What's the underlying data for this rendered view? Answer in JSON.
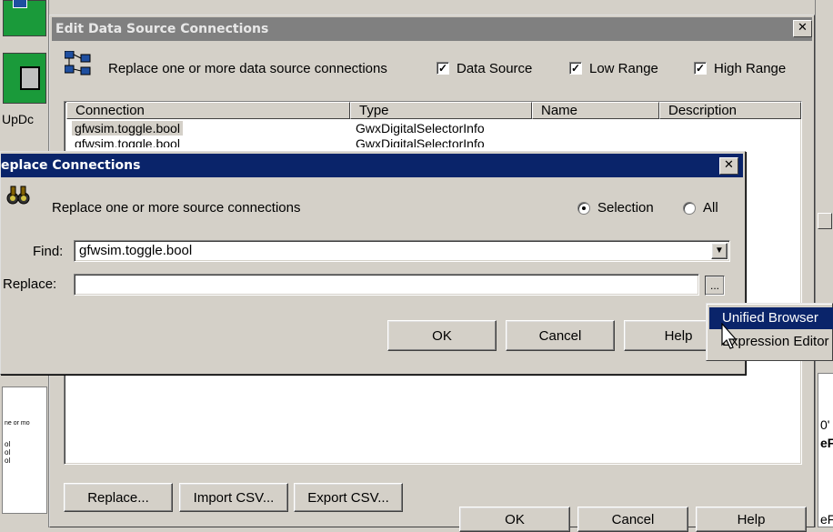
{
  "background": {
    "left_strip_text_1": "UpDc",
    "left_strip_text_2": "ne or mo",
    "left_strip_text_3": "ol",
    "left_strip_text_4": "ol",
    "left_strip_text_5": "ol",
    "right_strip_text_1": "0'",
    "right_strip_text_2": "eF",
    "right_strip_text_3": "eF"
  },
  "edit_dialog": {
    "title": "Edit Data Source Connections",
    "close_glyph": "✕",
    "description": "Replace one or more data source connections",
    "checkboxes": [
      {
        "label": "Data Source",
        "checked": true
      },
      {
        "label": "Low Range",
        "checked": true
      },
      {
        "label": "High Range",
        "checked": true
      }
    ],
    "check_glyph": "✓",
    "columns": [
      "Connection",
      "Type",
      "Name",
      "Description"
    ],
    "rows": [
      {
        "connection": "gfwsim.toggle.bool",
        "type": "GwxDigitalSelectorInfo",
        "name": "",
        "description": ""
      },
      {
        "connection": "gfwsim.toggle.bool",
        "type": "GwxDigitalSelectorInfo",
        "name": "",
        "description": ""
      }
    ],
    "buttons": {
      "replace": "Replace...",
      "import_csv": "Import CSV...",
      "export_csv": "Export CSV...",
      "ok": "OK",
      "cancel": "Cancel",
      "help": "Help"
    }
  },
  "replace_dialog": {
    "title": "eplace Connections",
    "close_glyph": "✕",
    "description": "Replace one or more source connections",
    "scope": {
      "selection_label": "Selection",
      "all_label": "All",
      "selected": "Selection"
    },
    "find_label": "Find:",
    "find_value": "gfwsim.toggle.bool",
    "replace_label": "Replace:",
    "replace_value": "",
    "browse_button": "...",
    "dropdown_arrow": "▼",
    "buttons": {
      "ok": "OK",
      "cancel": "Cancel",
      "help": "Help"
    }
  },
  "context_menu": {
    "items": [
      {
        "label": "Unified Browser",
        "highlighted": true
      },
      {
        "label": "Expression Editor",
        "highlighted": false
      }
    ]
  },
  "colors": {
    "title_bar_active": "#0a246a",
    "title_bar_inactive": "#808080",
    "menu_highlight": "#0a246a",
    "face": "#d4d0c8"
  }
}
